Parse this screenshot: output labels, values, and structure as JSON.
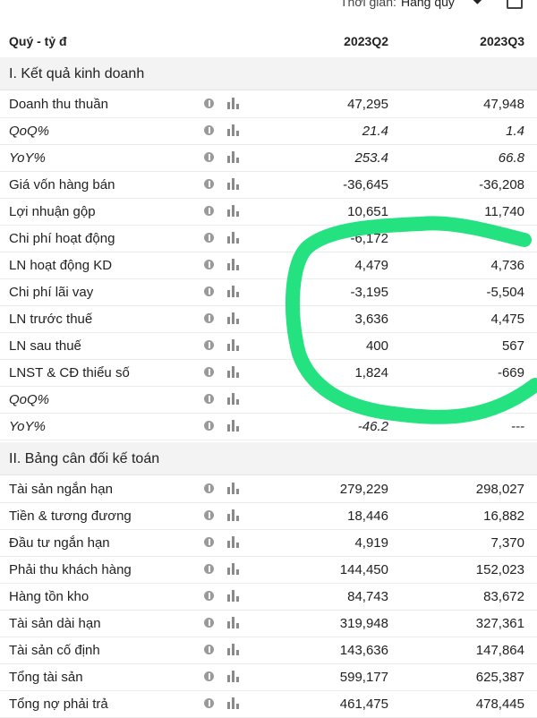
{
  "topbar": {
    "period_label": "Thời gian:",
    "period_value": "Hàng quý"
  },
  "header": {
    "title": "Quý - tỷ đ",
    "columns": [
      "2023Q2",
      "2023Q3"
    ]
  },
  "sections": [
    {
      "title": "I. Kết quả kinh doanh",
      "rows": [
        {
          "label": "Doanh thu thuần",
          "values": [
            "47,295",
            "47,948"
          ],
          "italic": false
        },
        {
          "label": "QoQ%",
          "values": [
            "21.4",
            "1.4"
          ],
          "italic": true
        },
        {
          "label": "YoY%",
          "values": [
            "253.4",
            "66.8"
          ],
          "italic": true
        },
        {
          "label": "Giá vốn hàng bán",
          "values": [
            "-36,645",
            "-36,208"
          ],
          "italic": false
        },
        {
          "label": "Lợi nhuận gộp",
          "values": [
            "10,651",
            "11,740"
          ],
          "italic": false
        },
        {
          "label": "Chi phí hoạt động",
          "values": [
            "-6,172",
            ""
          ],
          "italic": false
        },
        {
          "label": "LN hoạt động KD",
          "values": [
            "4,479",
            "4,736"
          ],
          "italic": false
        },
        {
          "label": "Chi phí lãi vay",
          "values": [
            "-3,195",
            "-5,504"
          ],
          "italic": false
        },
        {
          "label": "LN trước thuế",
          "values": [
            "3,636",
            "4,475"
          ],
          "italic": false
        },
        {
          "label": "LN sau thuế",
          "values": [
            "400",
            "567"
          ],
          "italic": false
        },
        {
          "label": "LNST & CĐ thiểu số",
          "values": [
            "1,824",
            "-669"
          ],
          "italic": false
        },
        {
          "label": "QoQ%",
          "values": [
            "",
            ""
          ],
          "italic": true
        },
        {
          "label": "YoY%",
          "values": [
            "-46.2",
            "---"
          ],
          "italic": true
        }
      ]
    },
    {
      "title": "II. Bảng cân đối kế toán",
      "rows": [
        {
          "label": "Tài sản ngắn hạn",
          "values": [
            "279,229",
            "298,027"
          ],
          "italic": false
        },
        {
          "label": "Tiền & tương đương",
          "values": [
            "18,446",
            "16,882"
          ],
          "italic": false
        },
        {
          "label": "Đầu tư ngắn hạn",
          "values": [
            "4,919",
            "7,370"
          ],
          "italic": false
        },
        {
          "label": "Phải thu khách hàng",
          "values": [
            "144,450",
            "152,023"
          ],
          "italic": false
        },
        {
          "label": "Hàng tồn kho",
          "values": [
            "84,743",
            "83,672"
          ],
          "italic": false
        },
        {
          "label": "Tài sản dài hạn",
          "values": [
            "319,948",
            "327,361"
          ],
          "italic": false
        },
        {
          "label": "Tài sản cố định",
          "values": [
            "143,636",
            "147,864"
          ],
          "italic": false
        },
        {
          "label": "Tổng tài sản",
          "values": [
            "599,177",
            "625,387"
          ],
          "italic": false
        },
        {
          "label": "Tổng nợ phải trả",
          "values": [
            "461,475",
            "478,445"
          ],
          "italic": false
        }
      ]
    }
  ],
  "colors": {
    "annotation": "#19e07a",
    "section_bg": "#f3f3f3"
  }
}
